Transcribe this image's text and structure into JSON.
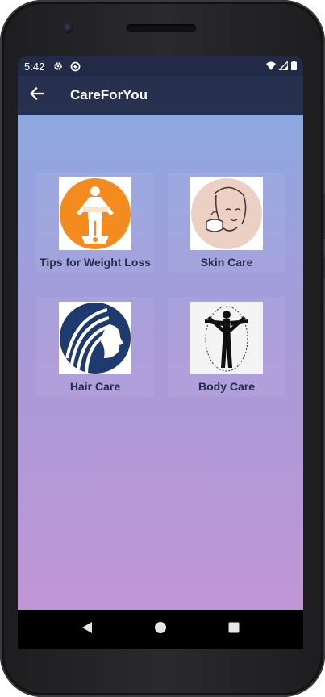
{
  "status_bar": {
    "time": "5:42",
    "icons": [
      "settings-icon",
      "sync-icon",
      "wifi-icon",
      "cellular-signal-icon",
      "battery-icon"
    ]
  },
  "app_bar": {
    "title": "CareForYou",
    "back_icon": "arrow-left-icon"
  },
  "categories": [
    {
      "label": "Tips for Weight Loss",
      "icon": "weight-loss-image"
    },
    {
      "label": "Skin Care",
      "icon": "skin-care-image"
    },
    {
      "label": "Hair Care",
      "icon": "hair-care-image"
    },
    {
      "label": "Body Care",
      "icon": "body-care-image"
    }
  ],
  "nav_bar": {
    "buttons": [
      "back-triangle-icon",
      "home-circle-icon",
      "recents-square-icon"
    ]
  },
  "colors": {
    "app_bar": "#283050",
    "status_bar": "#222a48",
    "gradient_top": "#8ea8e0",
    "gradient_bottom": "#c196d8",
    "label_text": "#262d4b"
  }
}
